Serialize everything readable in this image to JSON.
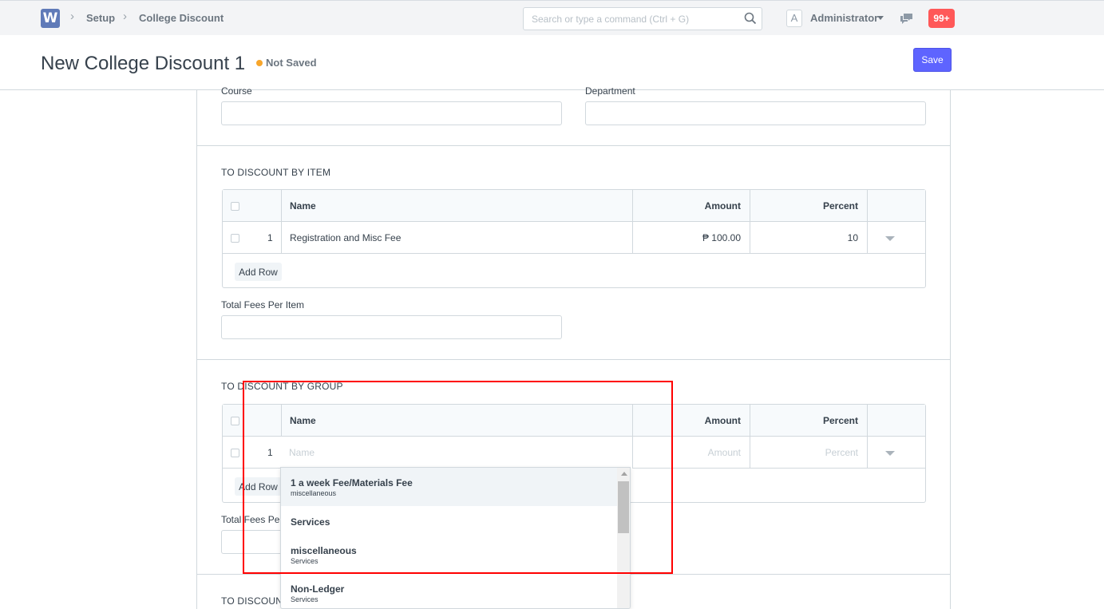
{
  "navbar": {
    "logo_letter": "W",
    "breadcrumbs": [
      "Setup",
      "College Discount"
    ],
    "search_placeholder": "Search or type a command (Ctrl + G)",
    "avatar_letter": "A",
    "user_name": "Administrator",
    "notification_count": "99+"
  },
  "page": {
    "title": "New College Discount 1",
    "status": "Not Saved",
    "save_label": "Save",
    "status_color": "#f8a62b",
    "primary_color": "#5e64ff"
  },
  "fields": {
    "course_label": "Course",
    "department_label": "Department",
    "total_fees_item_label": "Total Fees Per Item",
    "total_fees_group_label": "Total Fees Per"
  },
  "section_item": {
    "heading": "TO DISCOUNT BY ITEM",
    "columns": [
      "Name",
      "Amount",
      "Percent"
    ],
    "rows": [
      {
        "idx": "1",
        "name": "Registration and Misc Fee",
        "amount": "₱ 100.00",
        "percent": "10"
      }
    ],
    "add_row": "Add Row"
  },
  "section_group": {
    "heading": "TO DISCOUNT BY GROUP",
    "columns": [
      "Name",
      "Amount",
      "Percent"
    ],
    "row": {
      "idx": "1",
      "name_placeholder": "Name",
      "amount_placeholder": "Amount",
      "percent_placeholder": "Percent"
    },
    "add_row": "Add Row"
  },
  "section_next": {
    "heading": "TO DISCOUNT"
  },
  "dropdown": {
    "items": [
      {
        "title": "1 a week Fee/Materials Fee",
        "sub": "miscellaneous"
      },
      {
        "title": "Services",
        "sub": ""
      },
      {
        "title": "miscellaneous",
        "sub": "Services"
      },
      {
        "title": "Non-Ledger",
        "sub": "Services"
      }
    ]
  }
}
